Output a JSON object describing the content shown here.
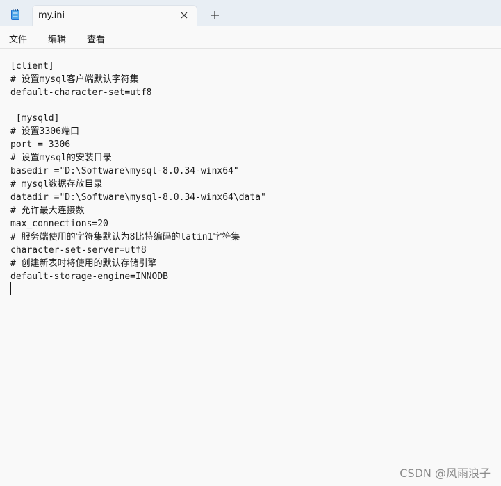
{
  "tab": {
    "title": "my.ini"
  },
  "icons": {
    "app": "notepad-icon",
    "close": "close-icon",
    "new_tab": "plus-icon"
  },
  "menu": [
    {
      "label": "文件"
    },
    {
      "label": "编辑"
    },
    {
      "label": "查看"
    }
  ],
  "editor": {
    "lines": [
      "[client]",
      "# 设置mysql客户端默认字符集",
      "default-character-set=utf8",
      "",
      " [mysqld]",
      "# 设置3306端口",
      "port = 3306",
      "# 设置mysql的安装目录",
      "basedir =\"D:\\Software\\mysql-8.0.34-winx64\"",
      "# mysql数据存放目录",
      "datadir =\"D:\\Software\\mysql-8.0.34-winx64\\data\"",
      "# 允许最大连接数",
      "max_connections=20",
      "# 服务端使用的字符集默认为8比特编码的latin1字符集",
      "character-set-server=utf8",
      "# 创建新表时将使用的默认存储引擎",
      "default-storage-engine=INNODB"
    ]
  },
  "watermark": "CSDN @风雨浪子",
  "colors": {
    "titlebar": "#e8eef4",
    "background": "#f9f9f9",
    "text": "#1a1a1a",
    "icon_blue": "#1f6fd1"
  }
}
